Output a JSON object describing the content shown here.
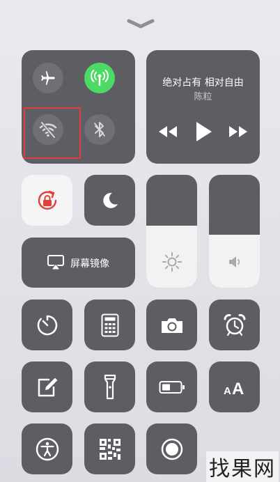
{
  "music": {
    "title": "绝对占有 相对自由",
    "artist": "陈粒"
  },
  "screen_mirroring": {
    "label": "屏幕镜像"
  },
  "brightness_level": 0.55,
  "volume_level": 0.47,
  "watermark": "找果网",
  "colors": {
    "tile": "#5d5d63",
    "green": "#4cd964",
    "rotation_lock_red": "#e1413b",
    "highlight_red": "#e23b3b"
  },
  "icons": [
    "chevron-down-icon",
    "airplane-icon",
    "cellular-icon",
    "wifi-off-icon",
    "bluetooth-icon",
    "rewind-icon",
    "play-icon",
    "fast-forward-icon",
    "rotation-lock-icon",
    "moon-icon",
    "screen-mirroring-icon",
    "brightness-icon",
    "volume-icon",
    "timer-icon",
    "calculator-icon",
    "camera-icon",
    "alarm-icon",
    "notes-icon",
    "flashlight-icon",
    "battery-icon",
    "text-size-icon",
    "accessibility-icon",
    "qr-code-icon",
    "screen-record-icon"
  ]
}
